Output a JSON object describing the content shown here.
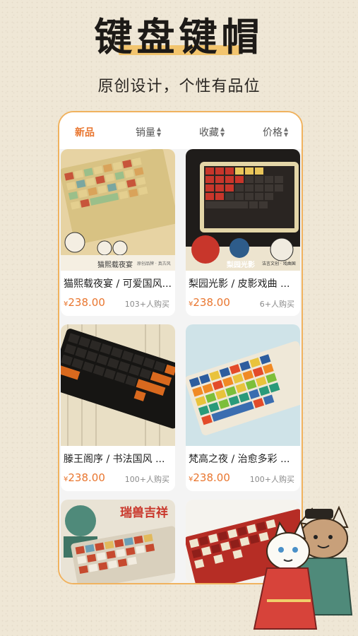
{
  "header": {
    "title": "键盘键帽",
    "subtitle": "原创设计，个性有品位"
  },
  "tabs": [
    {
      "label": "新品",
      "active": true
    },
    {
      "label": "销量",
      "sort": true
    },
    {
      "label": "收藏",
      "sort": true
    },
    {
      "label": "价格",
      "sort": true
    }
  ],
  "products": [
    {
      "title": "猫熙载夜宴 / 可爱国风...",
      "price_symbol": "¥",
      "price": "238.00",
      "sold": "103+人购买",
      "banner": "猫熙载夜宴",
      "tag": "原创品牌 · 真古风"
    },
    {
      "title": "梨园光影 / 皮影戏曲 ...",
      "price_symbol": "¥",
      "price": "238.00",
      "sold": "6+人购买",
      "banner": "梨园光影",
      "tag": "洁言文创 · 戏曲国"
    },
    {
      "title": "滕王阁序 / 书法国风 ...",
      "price_symbol": "¥",
      "price": "238.00",
      "sold": "100+人购买"
    },
    {
      "title": "梵高之夜 / 治愈多彩 ...",
      "price_symbol": "¥",
      "price": "238.00",
      "sold": "100+人购买"
    },
    {
      "title": "",
      "banner": "瑞兽吉祥"
    },
    {
      "title": ""
    }
  ],
  "colors": {
    "accent": "#e9762f",
    "phone_border": "#f0b25e",
    "highlight": "#f2c46d"
  },
  "icons": [
    "sort-icon"
  ]
}
